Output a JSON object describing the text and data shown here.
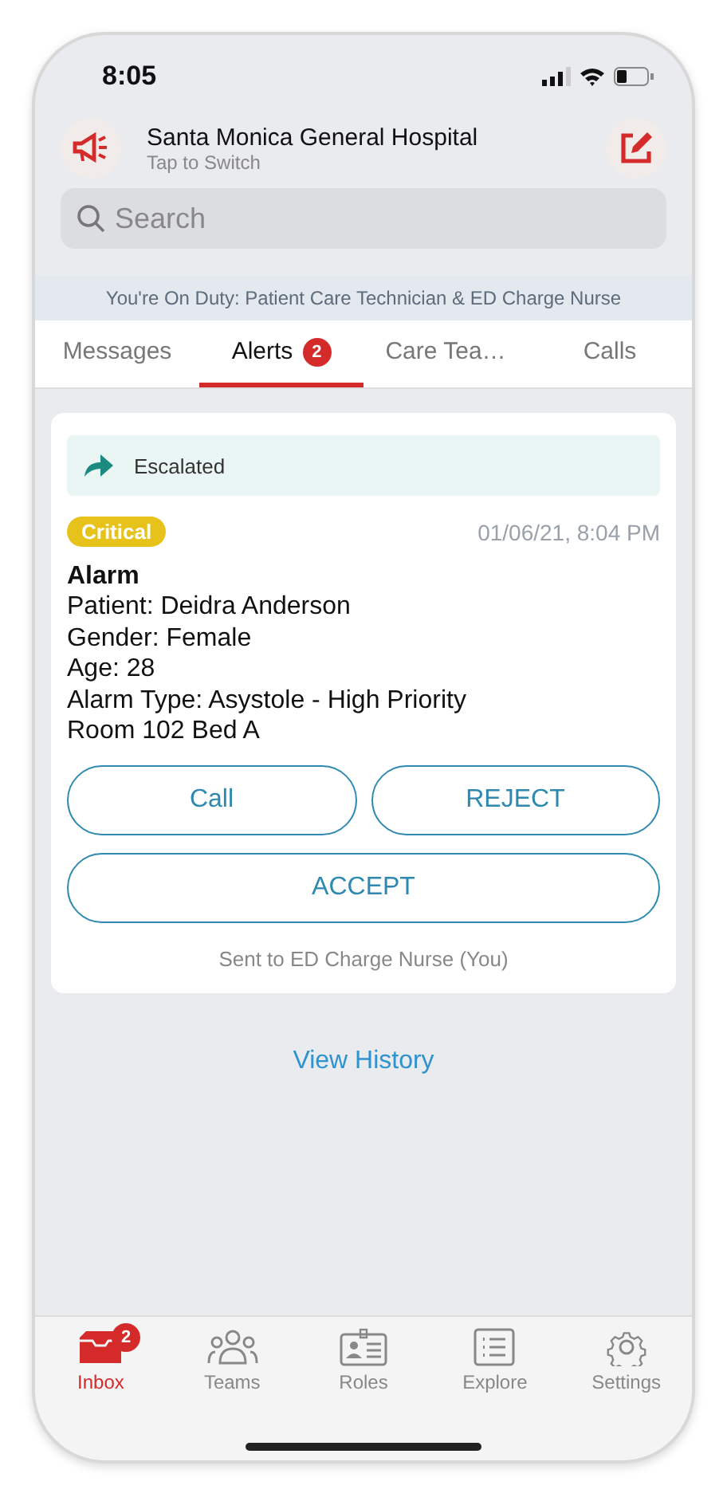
{
  "status_bar": {
    "time": "8:05"
  },
  "header": {
    "title": "Santa Monica General Hospital",
    "subtitle": "Tap to Switch"
  },
  "search": {
    "placeholder": "Search"
  },
  "duty_banner": "You're On Duty: Patient Care Technician & ED Charge Nurse",
  "tabs": [
    {
      "label": "Messages",
      "selected": false
    },
    {
      "label": "Alerts",
      "selected": true,
      "badge": "2"
    },
    {
      "label": "Care Tea…",
      "selected": false
    },
    {
      "label": "Calls",
      "selected": false
    }
  ],
  "alert": {
    "status": "Escalated",
    "priority": "Critical",
    "time": "01/06/21, 8:04 PM",
    "title": "Alarm",
    "details": [
      "Patient: Deidra Anderson",
      "Gender: Female",
      "Age: 28",
      "Alarm Type: Asystole - High Priority",
      "Room 102 Bed A"
    ],
    "buttons": [
      {
        "label": "Call",
        "kind": "half"
      },
      {
        "label": "REJECT",
        "kind": "half"
      },
      {
        "label": "ACCEPT",
        "kind": "full"
      }
    ],
    "note": "Sent to ED Charge Nurse (You)"
  },
  "view_history": "View History",
  "tab_bar": [
    {
      "label": "Inbox",
      "kind": "inbox",
      "selected": true,
      "badge": "2"
    },
    {
      "label": "Teams",
      "kind": "teams",
      "selected": false
    },
    {
      "label": "Roles",
      "kind": "roles",
      "selected": false
    },
    {
      "label": "Explore",
      "kind": "explore",
      "selected": false
    },
    {
      "label": "Settings",
      "kind": "settings",
      "selected": false
    }
  ]
}
